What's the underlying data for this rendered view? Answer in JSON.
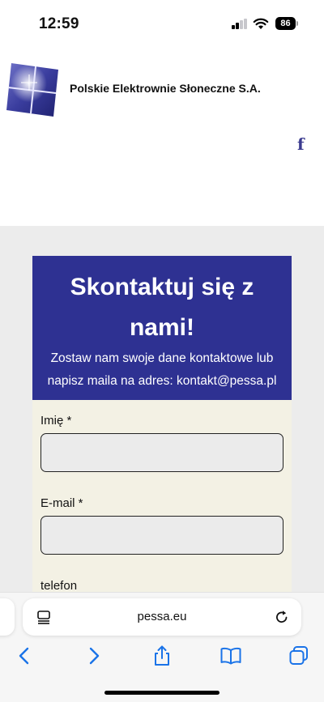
{
  "status": {
    "time": "12:59",
    "battery": "86"
  },
  "header": {
    "company_name": "Polskie Elektrownie Słoneczne S.A.",
    "logo_icon": "solar-panel-logo-icon",
    "social_icon": "facebook-icon",
    "social_glyph": "f"
  },
  "contact": {
    "title": "Skontaktuj się z nami!",
    "subtitle": "Zostaw nam swoje dane kontaktowe lub napisz maila na adres: kontakt@pessa.pl",
    "fields": [
      {
        "label": "Imię *",
        "value": ""
      },
      {
        "label": "E-mail *",
        "value": ""
      },
      {
        "label": "telefon"
      }
    ]
  },
  "browser": {
    "url": "pessa.eu",
    "toolbar_icons": [
      "back-icon",
      "forward-icon",
      "share-icon",
      "bookmarks-icon",
      "tabs-icon"
    ]
  },
  "colors": {
    "brand_blue": "#2e3192",
    "form_background": "#f3f1e4",
    "page_gray": "#ececec",
    "safari_blue": "#1a73e8"
  }
}
